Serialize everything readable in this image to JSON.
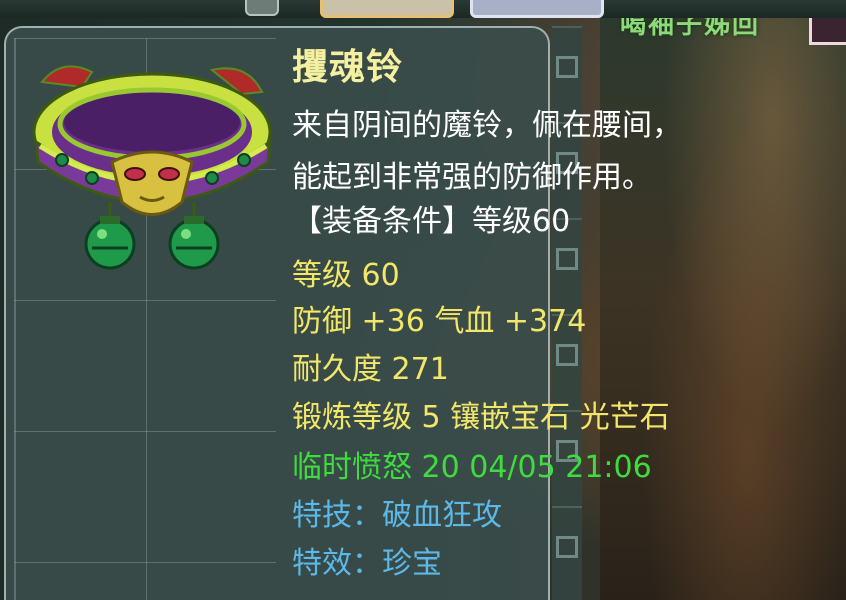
{
  "item": {
    "name": "攫魂铃",
    "description_lines": [
      "来自阴间的魔铃，佩在腰间，",
      "能起到非常强的防御作用。"
    ],
    "requirement": "【装备条件】等级60",
    "level": "等级 60",
    "stats": "防御 +36 气血 +374",
    "durability": "耐久度 271",
    "forge": "锻炼等级 5  镶嵌宝石 光芒石",
    "temporary": "临时愤怒 20 04/05 21:06",
    "special_skill": "特技：破血狂攻",
    "special_effect": "特效：珍宝"
  },
  "background": {
    "title_fragment": "喝袖子姊回"
  },
  "colors": {
    "name": "#f5f0a0",
    "description": "#ffffff",
    "stat": "#f3e76a",
    "temporary": "#3edc3e",
    "special": "#5cb8e8",
    "panel": "#3a4c4a"
  }
}
